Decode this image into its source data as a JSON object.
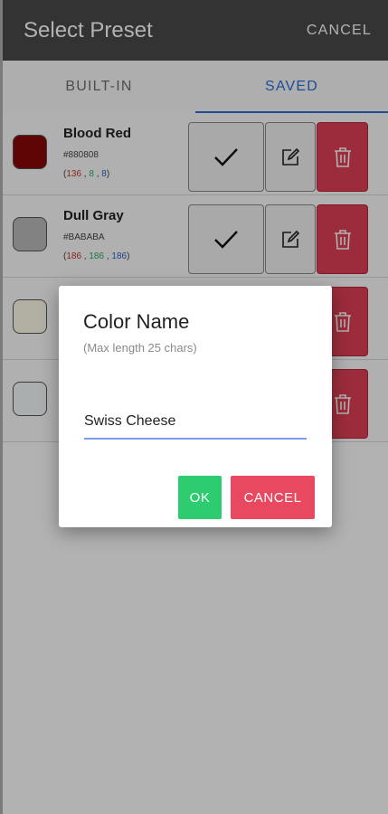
{
  "header": {
    "title": "Select Preset",
    "cancel_label": "CANCEL"
  },
  "tabs": [
    {
      "label": "BUILT-IN",
      "active": false
    },
    {
      "label": "SAVED",
      "active": true
    }
  ],
  "presets": [
    {
      "name": "Blood Red",
      "hex": "#880808",
      "color": "#880808",
      "r": "136",
      "g": "8",
      "b": "8"
    },
    {
      "name": "Dull Gray",
      "hex": "#BABABA",
      "color": "#BABABA",
      "r": "186",
      "g": "186",
      "b": "186"
    },
    {
      "name": "",
      "hex": "",
      "color": "#FFFDE8",
      "r": "",
      "g": "",
      "b": ""
    },
    {
      "name": "",
      "hex": "",
      "color": "#F4FAFA",
      "r": "",
      "g": "",
      "b": ""
    }
  ],
  "icons": {
    "apply": "check-icon",
    "edit": "edit-icon",
    "delete": "trash-icon"
  },
  "dialog": {
    "title": "Color Name",
    "hint": "(Max length 25 chars)",
    "input_value": "Swiss Cheese",
    "ok_label": "OK",
    "cancel_label": "CANCEL"
  },
  "colors": {
    "accent": "#2b6fd6",
    "ok": "#2ecc71",
    "danger": "#e84860",
    "header": "#4a4a4a"
  }
}
